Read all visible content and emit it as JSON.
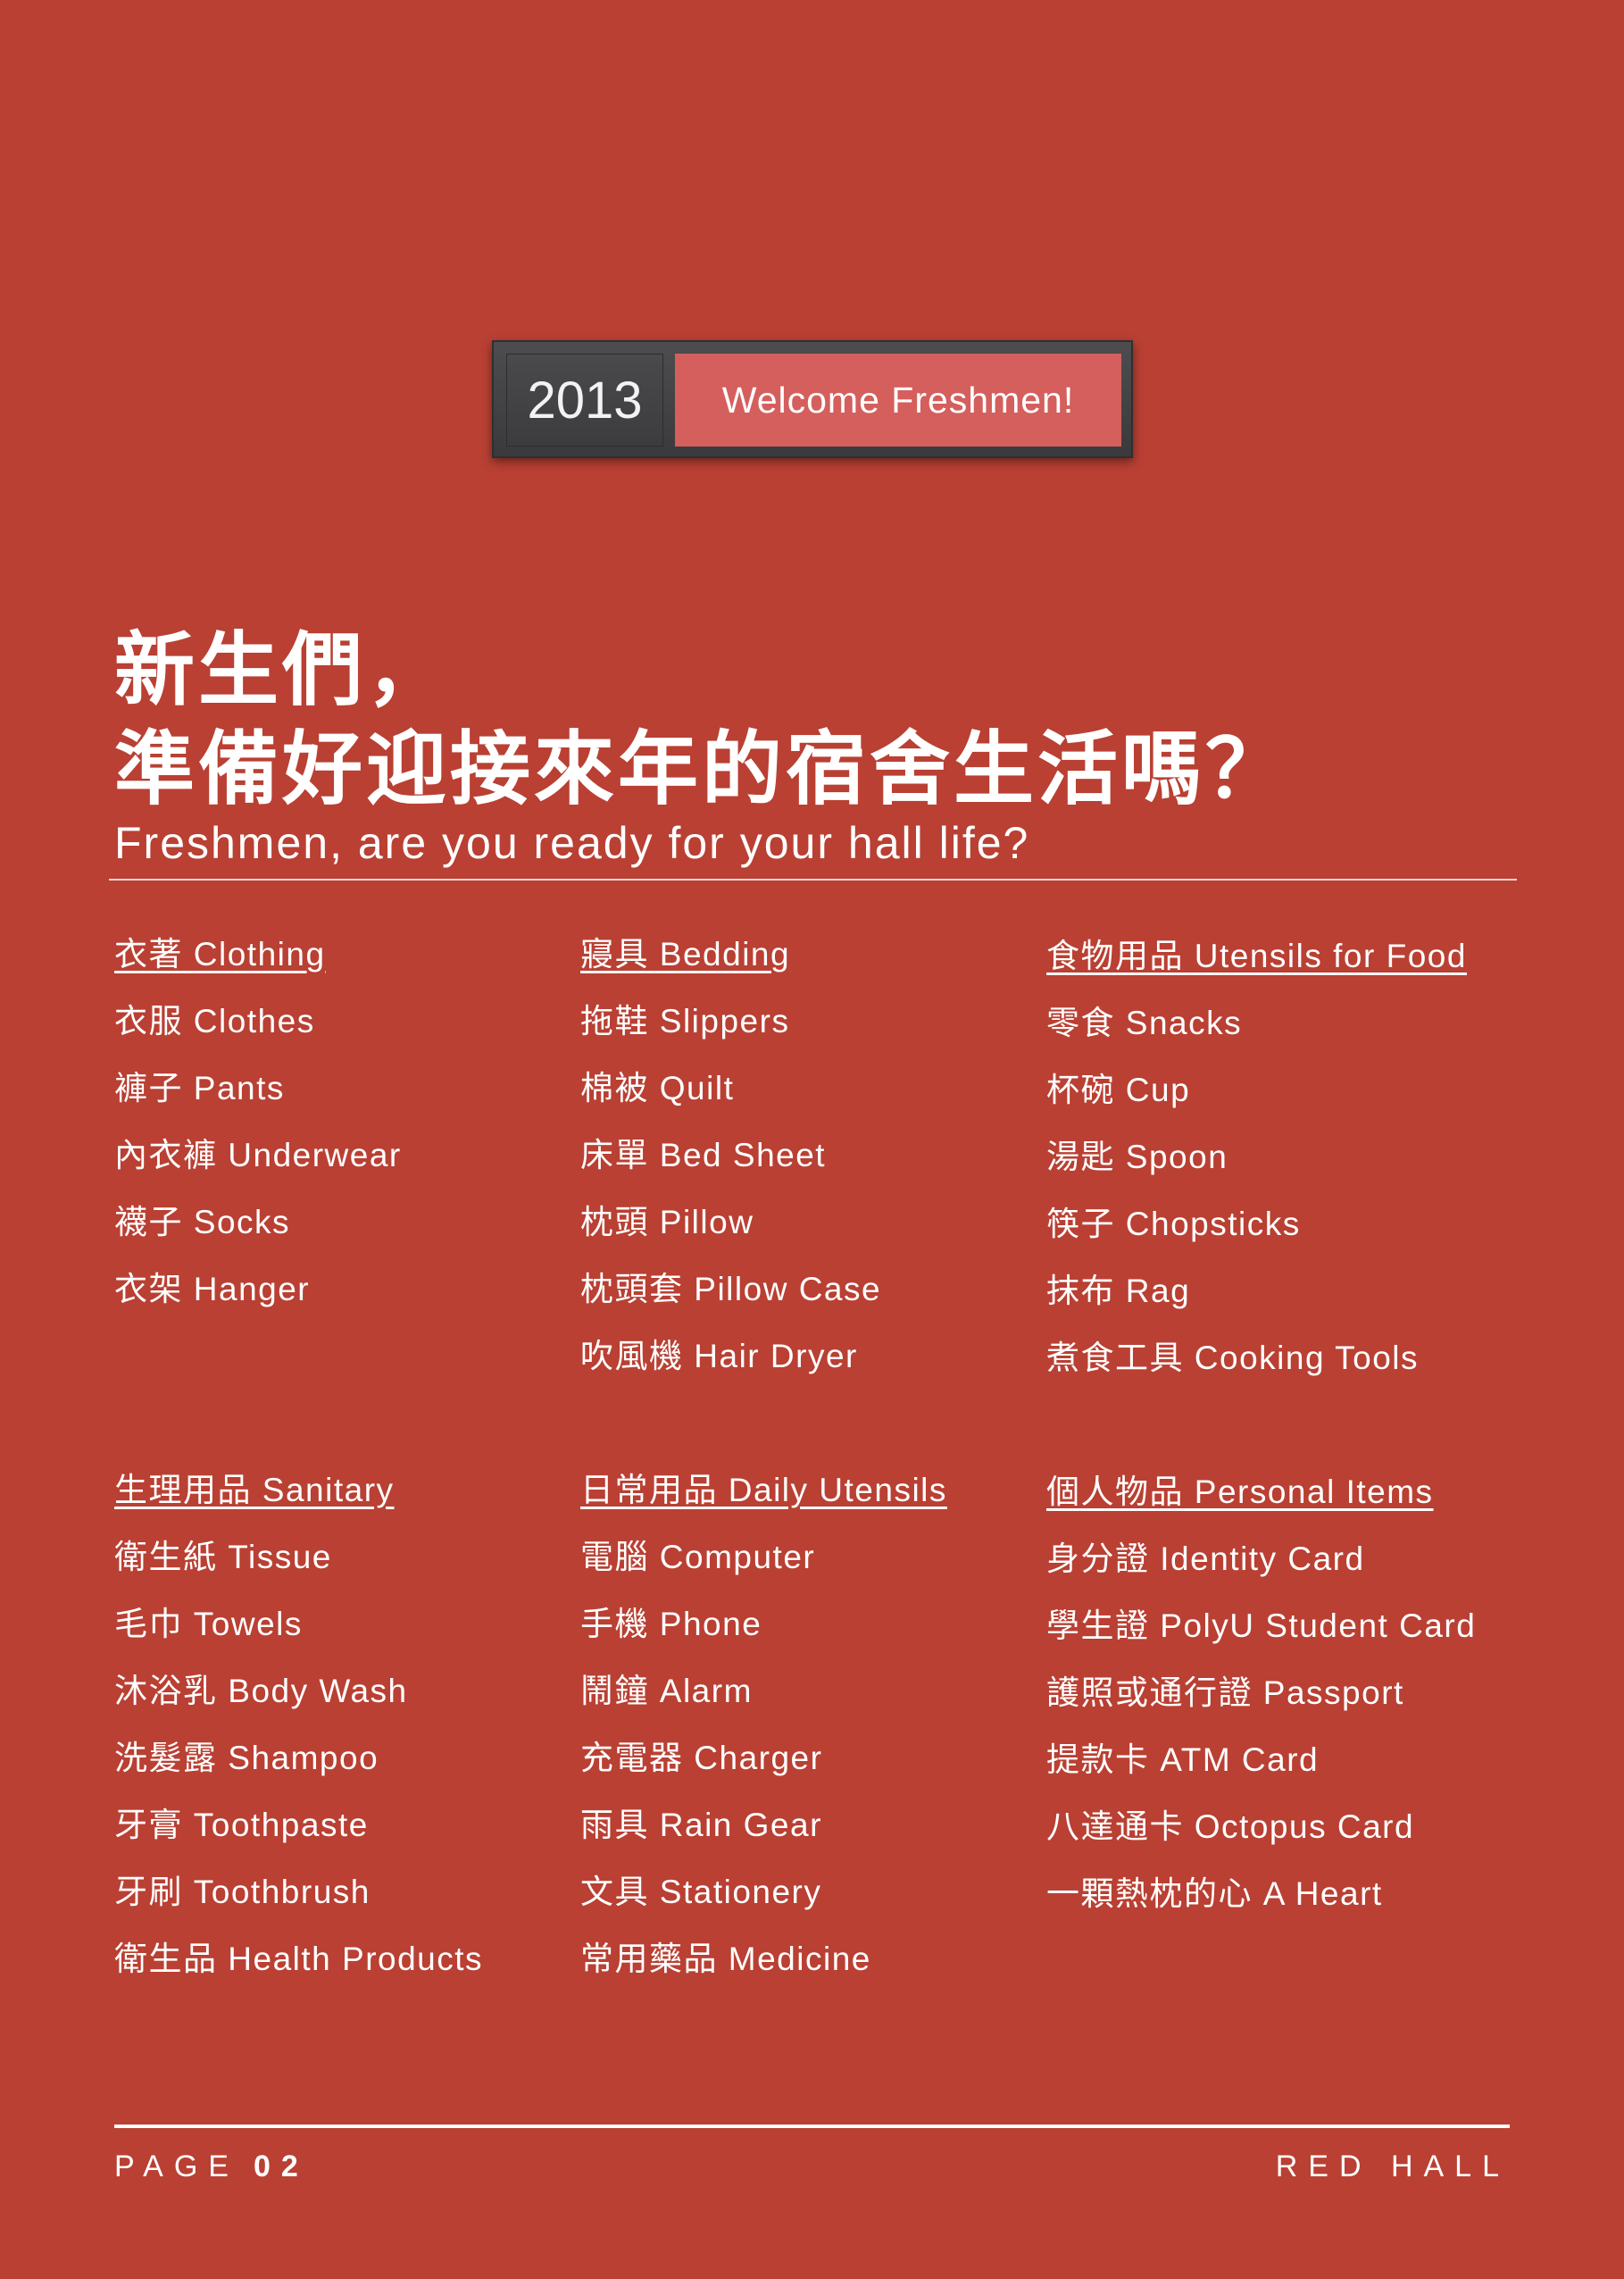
{
  "badge": {
    "year": "2013",
    "message": "Welcome Freshmen!"
  },
  "title": {
    "zh_line1": "新生們，",
    "zh_line2": "準備好迎接來年的宿舍生活嗎？",
    "en": "Freshmen, are you ready for your hall life?"
  },
  "sections": [
    {
      "heading": "衣著 Clothing",
      "items": [
        "衣服 Clothes",
        "褲子 Pants",
        "內衣褲 Underwear",
        "襪子 Socks",
        "衣架 Hanger"
      ]
    },
    {
      "heading": "寢具 Bedding",
      "items": [
        "拖鞋 Slippers",
        "棉被 Quilt",
        "床單 Bed Sheet",
        "枕頭 Pillow",
        "枕頭套 Pillow Case",
        "吹風機 Hair Dryer"
      ]
    },
    {
      "heading": "食物用品 Utensils for Food",
      "items": [
        "零食 Snacks",
        "杯碗 Cup",
        "湯匙 Spoon",
        "筷子 Chopsticks",
        "抹布 Rag",
        "煮食工具 Cooking Tools"
      ]
    },
    {
      "heading": "生理用品 Sanitary",
      "items": [
        "衛生紙 Tissue",
        "毛巾 Towels",
        "沐浴乳 Body Wash",
        "洗髮露 Shampoo",
        "牙膏 Toothpaste",
        "牙刷 Toothbrush",
        "衛生品 Health Products"
      ]
    },
    {
      "heading": "日常用品 Daily Utensils",
      "items": [
        "電腦 Computer",
        "手機 Phone",
        "鬧鐘 Alarm",
        "充電器 Charger",
        "雨具 Rain Gear",
        "文具 Stationery",
        "常用藥品 Medicine"
      ]
    },
    {
      "heading": "個人物品 Personal Items",
      "items": [
        "身分證 Identity Card",
        "學生證 PolyU Student Card",
        "護照或通行證 Passport",
        "提款卡 ATM Card",
        "八達通卡 Octopus Card",
        "一顆熱枕的心 A Heart"
      ]
    }
  ],
  "footer": {
    "page_label": "PAGE",
    "page_number": "02",
    "brand": "RED HALL"
  }
}
